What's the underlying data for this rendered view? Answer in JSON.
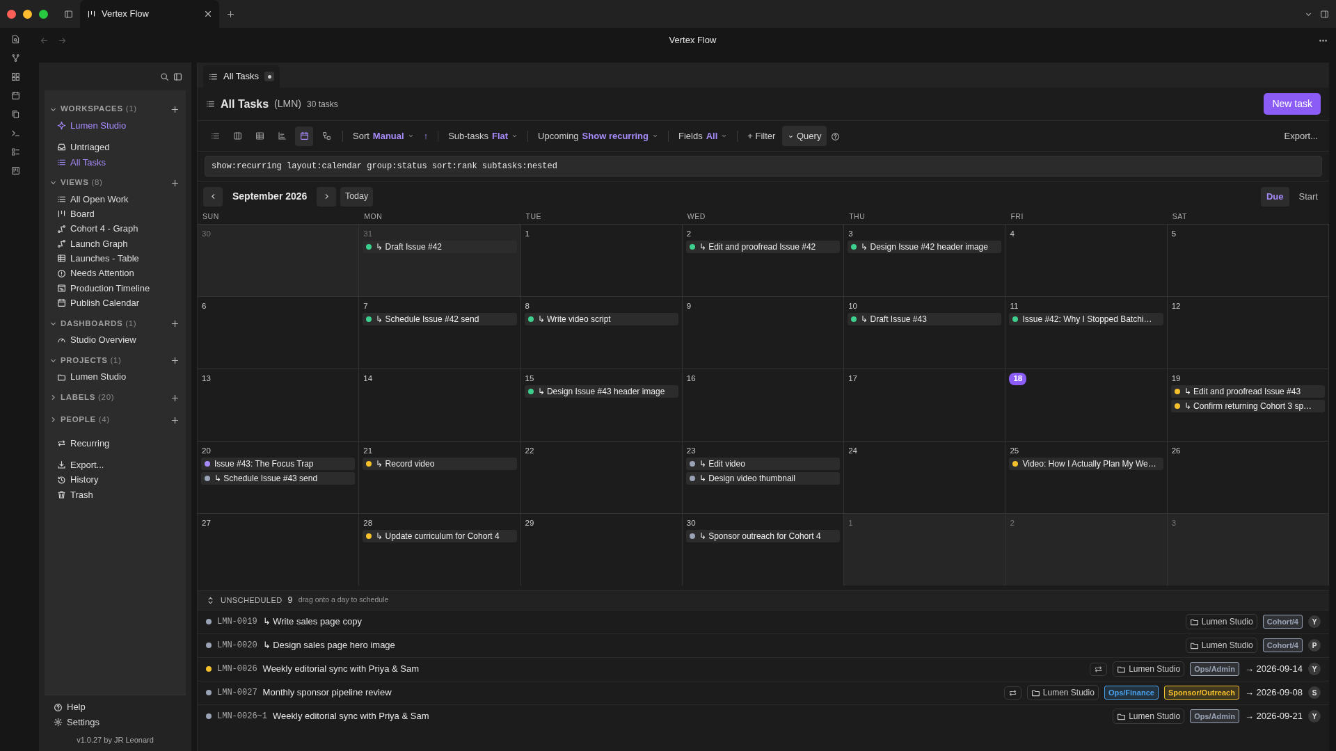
{
  "titlebar": {
    "tab": {
      "title": "Vertex Flow"
    }
  },
  "address_bar": {
    "title": "Vertex Flow"
  },
  "sidebar": {
    "groups": [
      {
        "kind": "section",
        "title": "WORKSPACES",
        "count": "(1)",
        "expanded": true,
        "items": [
          {
            "label": "Lumen Studio",
            "selected": true
          }
        ]
      },
      {
        "kind": "list",
        "items": [
          {
            "label": "Untriaged",
            "selected": false
          },
          {
            "label": "All Tasks",
            "selected": true
          }
        ]
      },
      {
        "kind": "section",
        "title": "VIEWS",
        "count": "(8)",
        "expanded": true,
        "items": [
          {
            "label": "All Open Work",
            "selected": false
          },
          {
            "label": "Board",
            "selected": false
          },
          {
            "label": "Cohort 4 - Graph",
            "selected": false
          },
          {
            "label": "Launch Graph",
            "selected": false
          },
          {
            "label": "Launches - Table",
            "selected": false
          },
          {
            "label": "Needs Attention",
            "selected": false
          },
          {
            "label": "Production Timeline",
            "selected": false
          },
          {
            "label": "Publish Calendar",
            "selected": false
          }
        ]
      },
      {
        "kind": "section",
        "title": "DASHBOARDS",
        "count": "(1)",
        "expanded": true,
        "items": [
          {
            "label": "Studio Overview",
            "selected": false
          }
        ]
      },
      {
        "kind": "section",
        "title": "PROJECTS",
        "count": "(1)",
        "expanded": true,
        "items": [
          {
            "label": "Lumen Studio",
            "selected": false
          }
        ]
      },
      {
        "kind": "section",
        "title": "LABELS",
        "count": "(20)",
        "expanded": false
      },
      {
        "kind": "section",
        "title": "PEOPLE",
        "count": "(4)",
        "expanded": false
      },
      {
        "kind": "list",
        "items": [
          {
            "label": "Recurring",
            "selected": false
          }
        ]
      },
      {
        "kind": "list",
        "items": [
          {
            "label": "Export...",
            "selected": false
          },
          {
            "label": "History",
            "selected": false
          },
          {
            "label": "Trash",
            "selected": false
          }
        ]
      }
    ],
    "footer": [
      "Help",
      "Settings"
    ],
    "version": "v1.0.27 by JR Leonard"
  },
  "main": {
    "tab": {
      "title": "All Tasks"
    },
    "header": {
      "title": "All Tasks",
      "key": "(LMN)",
      "count": "30 tasks",
      "button": "New task"
    },
    "toolbar": {
      "views": [
        {
          "selected": false
        },
        {
          "selected": false
        },
        {
          "selected": false
        },
        {
          "selected": false
        },
        {
          "selected": true
        },
        {
          "selected": false
        }
      ],
      "controls": [
        {
          "label": "Sort",
          "value": "Manual",
          "direction": "↑"
        },
        {
          "label": "Sub-tasks",
          "value": "Flat"
        },
        {
          "label": "Upcoming",
          "value": "Show recurring"
        },
        {
          "label": "Fields",
          "value": "All"
        }
      ],
      "filter": "+ Filter",
      "query": {
        "label": "Query",
        "expanded": true
      },
      "export": "Export..."
    },
    "query": "show:recurring layout:calendar group:status sort:rank subtasks:nested",
    "calendar": {
      "month": "September 2026",
      "today_button": "Today",
      "modes": [
        {
          "label": "Due",
          "selected": true
        },
        {
          "label": "Start",
          "selected": false
        }
      ],
      "weekdays": [
        "SUN",
        "MON",
        "TUE",
        "WED",
        "THU",
        "FRI",
        "SAT"
      ],
      "weeks": [
        [
          {
            "date": "30",
            "other_month": true,
            "today": false
          },
          {
            "date": "31",
            "other_month": true,
            "today": false,
            "events": [
              {
                "title": "↳ Draft Issue #42",
                "color": "#3ecf8e"
              }
            ]
          },
          {
            "date": "1",
            "other_month": false,
            "today": false
          },
          {
            "date": "2",
            "other_month": false,
            "today": false,
            "events": [
              {
                "title": "↳ Edit and proofread Issue #42",
                "color": "#3ecf8e"
              }
            ]
          },
          {
            "date": "3",
            "other_month": false,
            "today": false,
            "events": [
              {
                "title": "↳ Design Issue #42 header image",
                "color": "#3ecf8e"
              }
            ]
          },
          {
            "date": "4",
            "other_month": false,
            "today": false
          },
          {
            "date": "5",
            "other_month": false,
            "today": false
          }
        ],
        [
          {
            "date": "6",
            "other_month": false,
            "today": false
          },
          {
            "date": "7",
            "other_month": false,
            "today": false,
            "events": [
              {
                "title": "↳ Schedule Issue #42 send",
                "color": "#3ecf8e"
              }
            ]
          },
          {
            "date": "8",
            "other_month": false,
            "today": false,
            "events": [
              {
                "title": "↳ Write video script",
                "color": "#3ecf8e"
              }
            ]
          },
          {
            "date": "9",
            "other_month": false,
            "today": false
          },
          {
            "date": "10",
            "other_month": false,
            "today": false,
            "events": [
              {
                "title": "↳ Draft Issue #43",
                "color": "#3ecf8e"
              }
            ]
          },
          {
            "date": "11",
            "other_month": false,
            "today": false,
            "events": [
              {
                "title": "Issue #42: Why I Stopped Batchi…",
                "color": "#3ecf8e"
              }
            ]
          },
          {
            "date": "12",
            "other_month": false,
            "today": false
          }
        ],
        [
          {
            "date": "13",
            "other_month": false,
            "today": false
          },
          {
            "date": "14",
            "other_month": false,
            "today": false
          },
          {
            "date": "15",
            "other_month": false,
            "today": false,
            "events": [
              {
                "title": "↳ Design Issue #43 header image",
                "color": "#3ecf8e"
              }
            ]
          },
          {
            "date": "16",
            "other_month": false,
            "today": false
          },
          {
            "date": "17",
            "other_month": false,
            "today": false
          },
          {
            "date": "18",
            "other_month": false,
            "today": true
          },
          {
            "date": "19",
            "other_month": false,
            "today": false,
            "events": [
              {
                "title": "↳ Edit and proofread Issue #43",
                "color": "#f5c02b"
              },
              {
                "title": "↳ Confirm returning Cohort 3 sp…",
                "color": "#f5c02b"
              }
            ]
          }
        ],
        [
          {
            "date": "20",
            "other_month": false,
            "today": false,
            "events": [
              {
                "title": "Issue #43: The Focus Trap",
                "color": "#a78bfa"
              },
              {
                "title": "↳ Schedule Issue #43 send",
                "color": "#9aa3b5"
              }
            ]
          },
          {
            "date": "21",
            "other_month": false,
            "today": false,
            "events": [
              {
                "title": "↳ Record video",
                "color": "#f5c02b"
              }
            ]
          },
          {
            "date": "22",
            "other_month": false,
            "today": false
          },
          {
            "date": "23",
            "other_month": false,
            "today": false,
            "events": [
              {
                "title": "↳ Edit video",
                "color": "#9aa3b5"
              },
              {
                "title": "↳ Design video thumbnail",
                "color": "#9aa3b5"
              }
            ]
          },
          {
            "date": "24",
            "other_month": false,
            "today": false
          },
          {
            "date": "25",
            "other_month": false,
            "today": false,
            "events": [
              {
                "title": "Video: How I Actually Plan My We…",
                "color": "#f5c02b"
              }
            ]
          },
          {
            "date": "26",
            "other_month": false,
            "today": false
          }
        ],
        [
          {
            "date": "27",
            "other_month": false,
            "today": false
          },
          {
            "date": "28",
            "other_month": false,
            "today": false,
            "events": [
              {
                "title": "↳ Update curriculum for Cohort 4",
                "color": "#f5c02b"
              }
            ]
          },
          {
            "date": "29",
            "other_month": false,
            "today": false
          },
          {
            "date": "30",
            "other_month": false,
            "today": false,
            "events": [
              {
                "title": "↳ Sponsor outreach for Cohort 4",
                "color": "#9aa3b5"
              }
            ]
          },
          {
            "date": "1",
            "other_month": true,
            "today": false
          },
          {
            "date": "2",
            "other_month": true,
            "today": false
          },
          {
            "date": "3",
            "other_month": true,
            "today": false
          }
        ]
      ]
    },
    "unscheduled": {
      "title": "UNSCHEDULED",
      "count": "9",
      "hint": "drag onto a day to schedule",
      "rows": [
        {
          "id": "LMN-0019",
          "title": "↳ Write sales page copy",
          "color": "#9aa3b5",
          "recurring": false,
          "project": "Lumen Studio",
          "tags": [
            {
              "label": "Cohort/4",
              "color": "#9aa3b5"
            }
          ],
          "assignee": "Y"
        },
        {
          "id": "LMN-0020",
          "title": "↳ Design sales page hero image",
          "color": "#9aa3b5",
          "recurring": false,
          "project": "Lumen Studio",
          "tags": [
            {
              "label": "Cohort/4",
              "color": "#9aa3b5"
            }
          ],
          "assignee": "P"
        },
        {
          "id": "LMN-0026",
          "title": "Weekly editorial sync with Priya & Sam",
          "color": "#f5c02b",
          "recurring": true,
          "project": "Lumen Studio",
          "tags": [
            {
              "label": "Ops/Admin",
              "color": "#9aa3b5"
            }
          ],
          "due": "→ 2026-09-14",
          "assignee": "Y"
        },
        {
          "id": "LMN-0027",
          "title": "Monthly sponsor pipeline review",
          "color": "#9aa3b5",
          "recurring": true,
          "project": "Lumen Studio",
          "tags": [
            {
              "label": "Ops/Finance",
              "color": "#4aa3f0"
            },
            {
              "label": "Sponsor/Outreach",
              "color": "#f5c02b"
            }
          ],
          "due": "→ 2026-09-08",
          "assignee": "S"
        },
        {
          "id": "LMN-0026~1",
          "title": "Weekly editorial sync with Priya & Sam",
          "color": "#9aa3b5",
          "recurring": false,
          "project": "Lumen Studio",
          "tags": [
            {
              "label": "Ops/Admin",
              "color": "#9aa3b5"
            }
          ],
          "due": "→ 2026-09-21",
          "assignee": "Y"
        }
      ]
    }
  }
}
